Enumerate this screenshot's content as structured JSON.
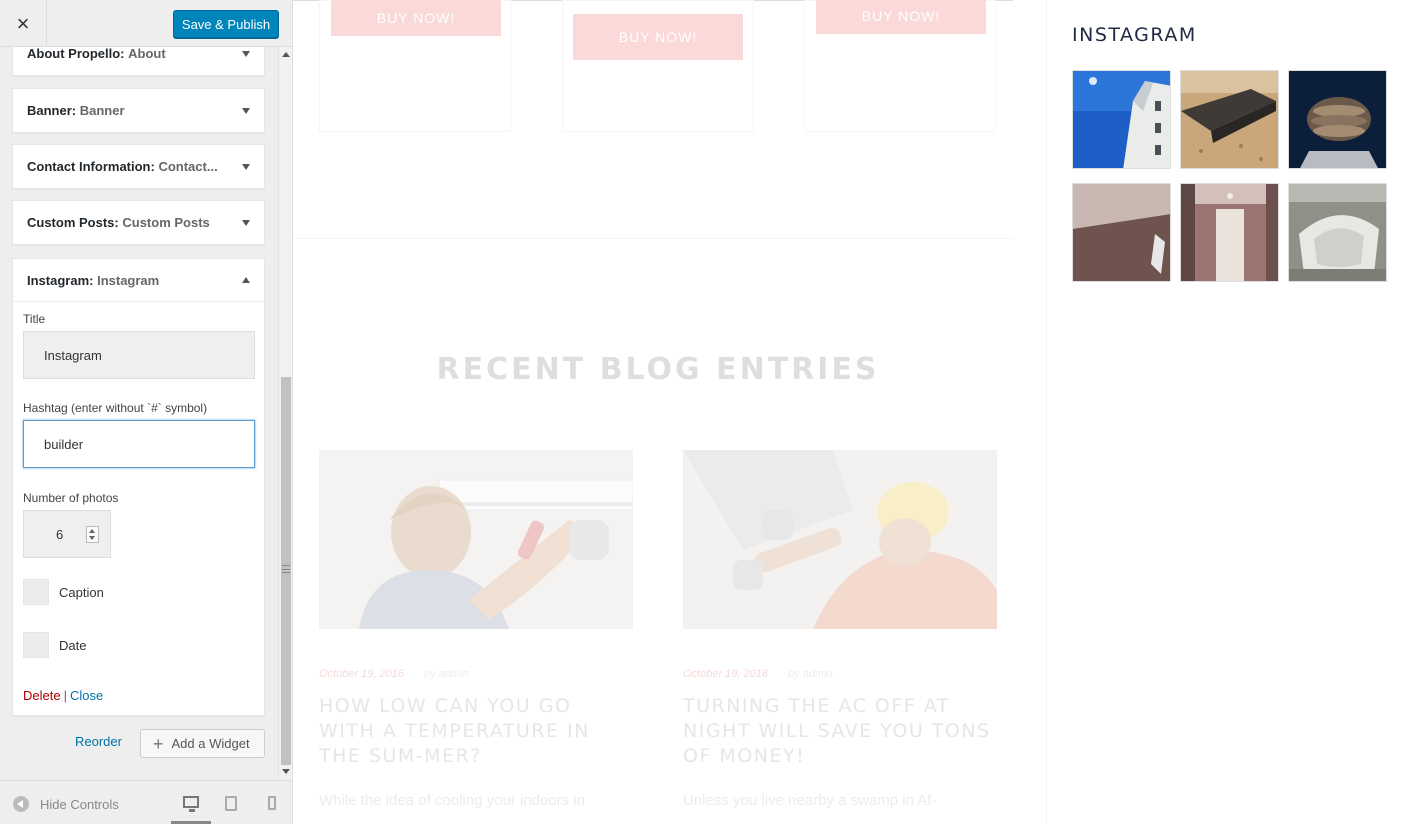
{
  "header": {
    "close_icon": "×",
    "publish_label": "Save & Publish"
  },
  "widgets": [
    {
      "name": "About Propello:",
      "title": "About"
    },
    {
      "name": "Banner:",
      "title": "Banner"
    },
    {
      "name": "Contact Information:",
      "title": "Contact..."
    },
    {
      "name": "Custom Posts:",
      "title": "Custom Posts"
    },
    {
      "name": "Instagram:",
      "title": "Instagram"
    }
  ],
  "instagram_form": {
    "title_label": "Title",
    "title_value": "Instagram",
    "hashtag_label": "Hashtag (enter without `#` symbol)",
    "hashtag_value": "builder",
    "count_label": "Number of photos",
    "count_value": "6",
    "caption_label": "Caption",
    "date_label": "Date",
    "delete_label": "Delete",
    "separator": "|",
    "close_label": "Close"
  },
  "sidebar_actions": {
    "reorder_label": "Reorder",
    "add_widget_label": "Add a Widget"
  },
  "footer": {
    "hide_controls_label": "Hide Controls"
  },
  "preview": {
    "buy_label": "BUY NOW!",
    "blog_heading": "RECENT BLOG ENTRIES",
    "posts": [
      {
        "date": "October 19, 2016",
        "author": "by admin",
        "title": "HOW LOW CAN YOU GO WITH A TEMPERATURE IN THE SUM-MER?",
        "excerpt": "While the idea of cooling your indoors in"
      },
      {
        "date": "October 19, 2016",
        "author": "by admin",
        "title": "TURNING THE AC OFF AT NIGHT WILL SAVE YOU TONS OF MONEY!",
        "excerpt": "Unless you live nearby a swamp in Af-"
      }
    ],
    "instagram_heading": "INSTAGRAM"
  },
  "colors": {
    "accent": "#0085ba",
    "link": "#0073aa",
    "delete": "#aa0000",
    "buy_button": "#fbd8d8"
  }
}
